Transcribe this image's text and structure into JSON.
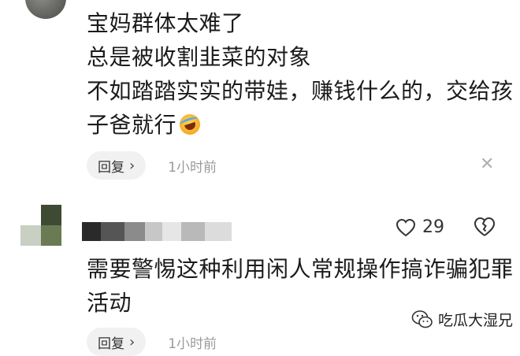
{
  "comment1": {
    "lines": [
      "宝妈群体太难了",
      "总是被收割韭菜的对象",
      "不如踏踏实实的带娃，赚钱什么的，交给孩",
      "子爸就行"
    ],
    "emoji": "laughing-crying-emoji",
    "reply_label": "回复",
    "time": "1小时前"
  },
  "comment2": {
    "lines": [
      "需要警惕这种利用闲人常规操作搞诈骗犯罪",
      "活动"
    ],
    "like_count": "29",
    "reply_label": "回复",
    "time": "1小时前"
  },
  "watermark": {
    "text": "吃瓜大湿兄"
  },
  "colors": {
    "text": "#1b1b1b",
    "muted": "#9a9a9a",
    "reply_bg": "#f1f1f1"
  }
}
